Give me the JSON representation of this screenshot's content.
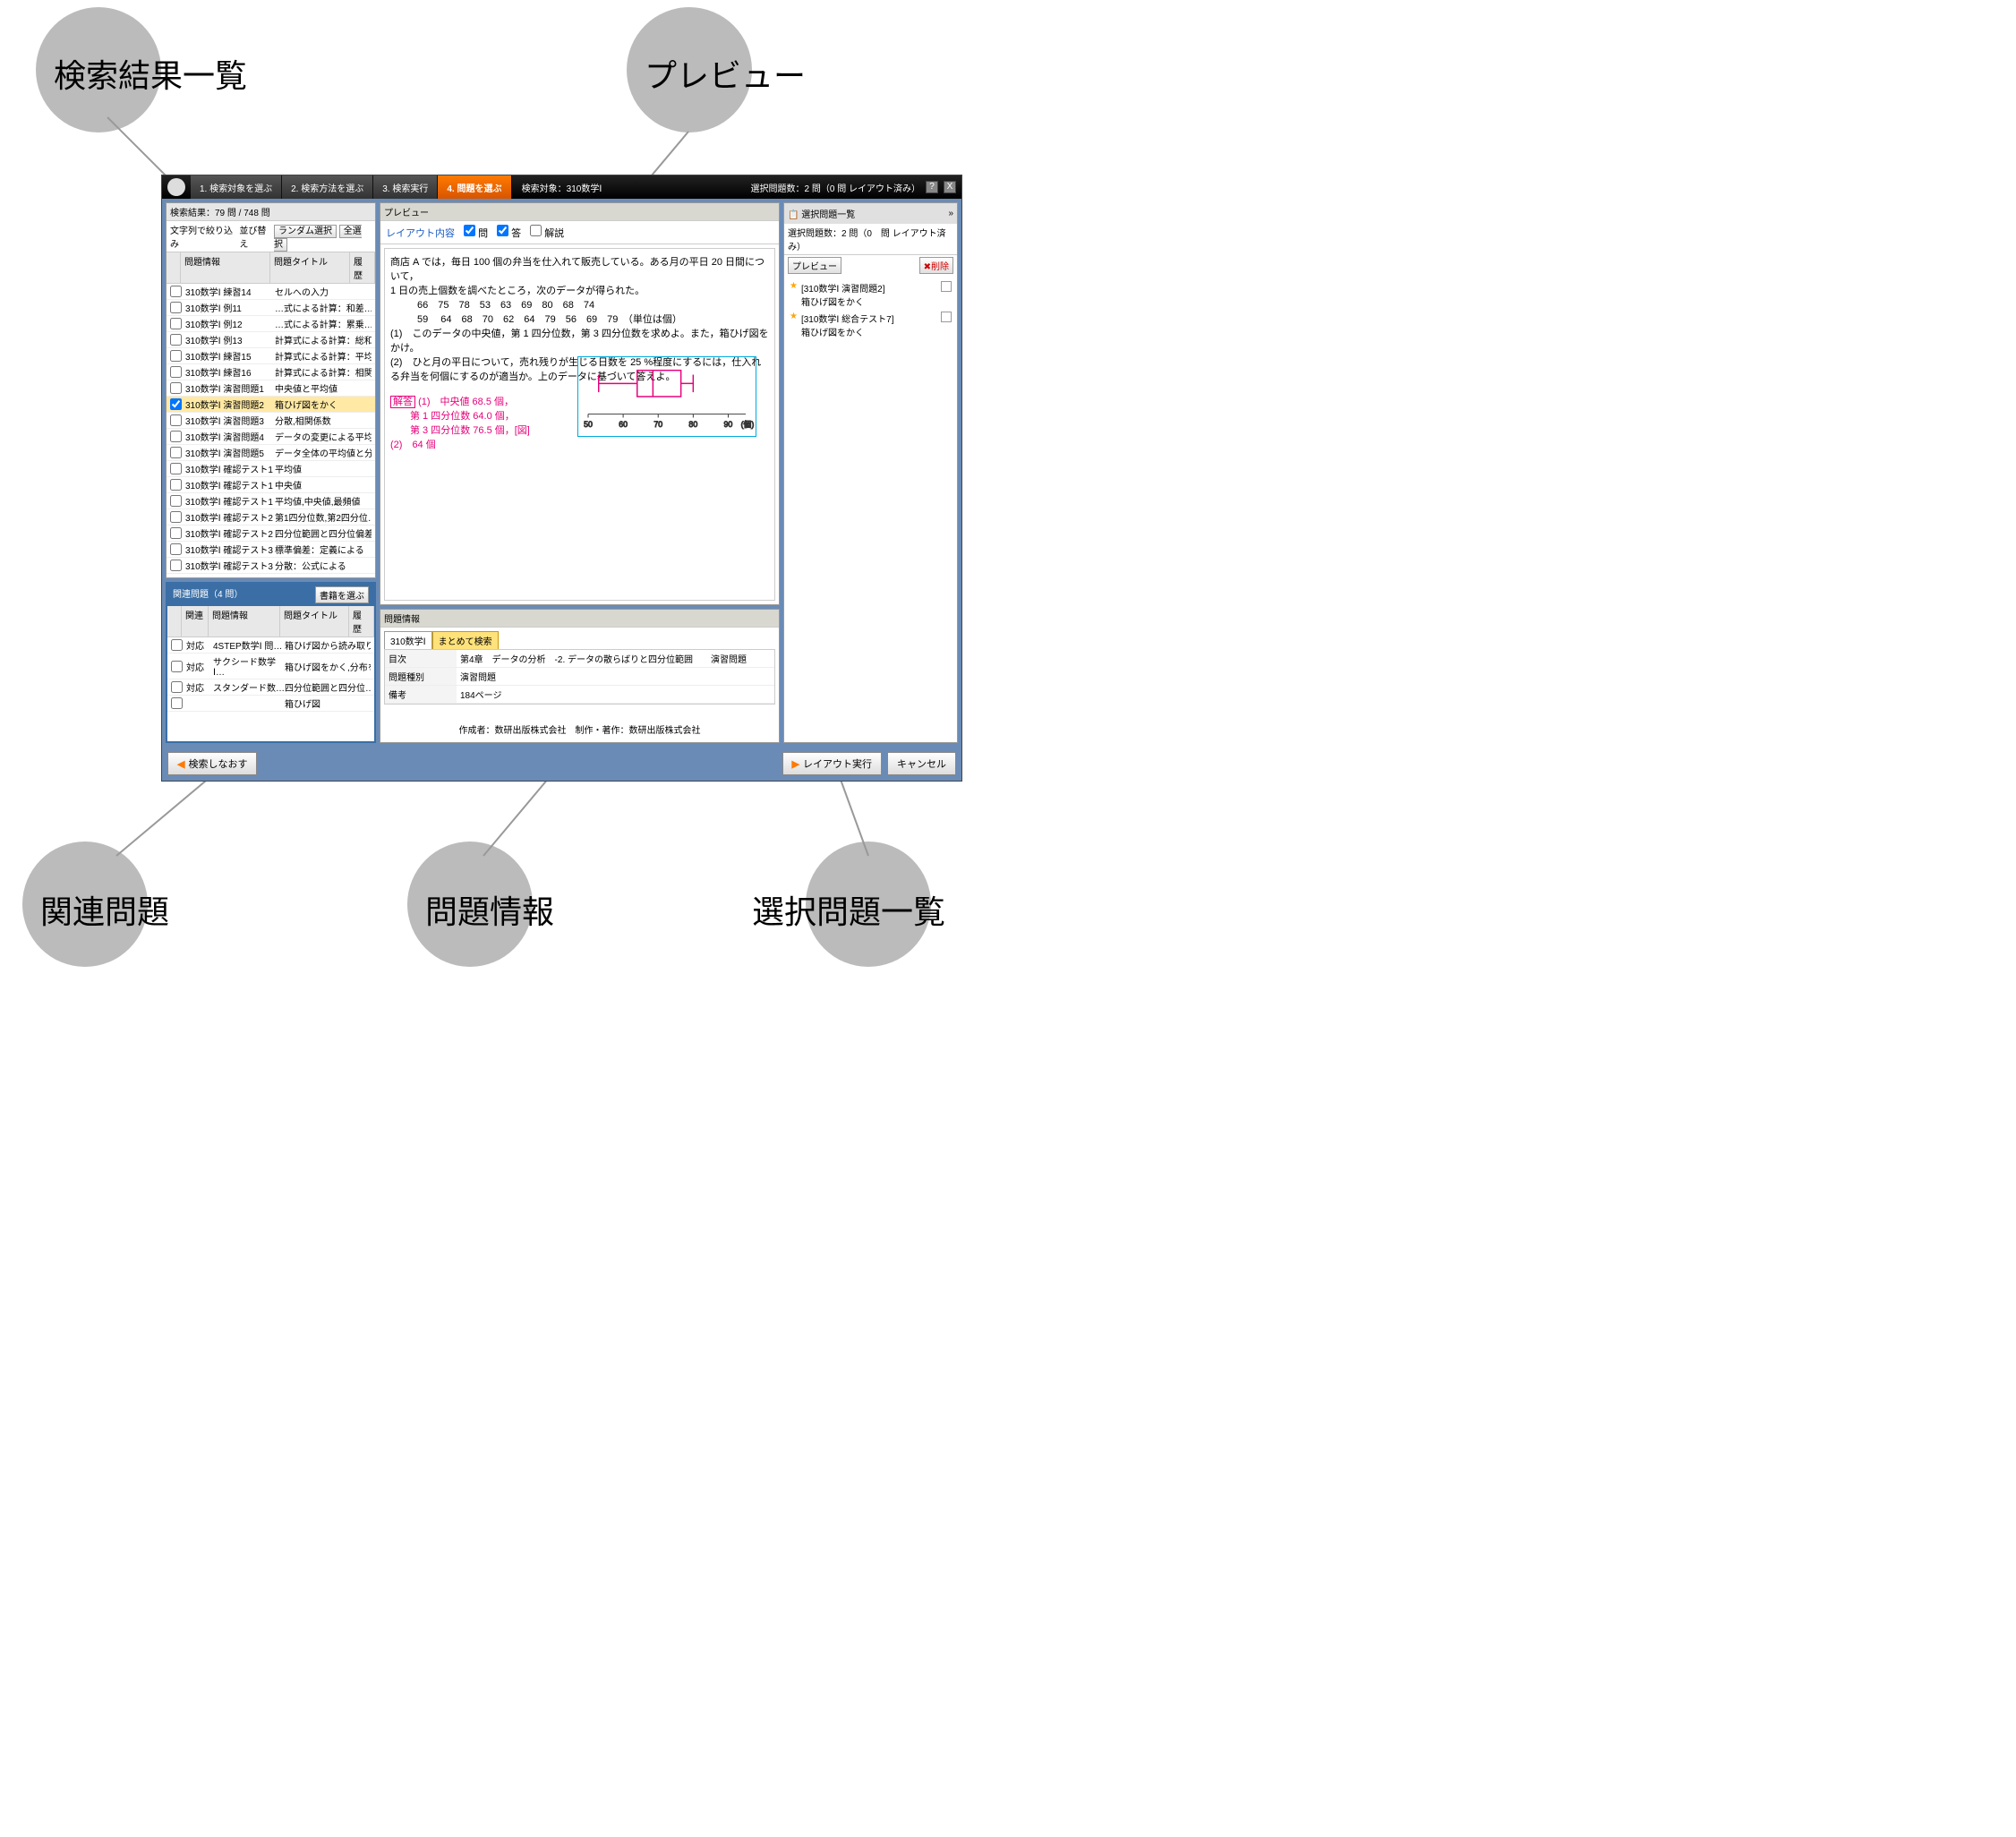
{
  "callouts": {
    "top_left": "検索結果一覧",
    "top_right": "プレビュー",
    "bottom_left": "関連問題",
    "bottom_mid": "問題情報",
    "bottom_right": "選択問題一覧"
  },
  "top": {
    "step1": "1. 検索対象を選ぶ",
    "step2": "2. 検索方法を選ぶ",
    "step3": "3. 検索実行",
    "step4": "4. 問題を選ぶ",
    "center": "検索対象：310数学Ⅰ",
    "right": "選択問題数：2 問（0 問 レイアウト済み）",
    "help": "?",
    "close": "X"
  },
  "search": {
    "result_header": "検索結果：79 問 / 748 問",
    "filter_label": "文字列で絞り込み",
    "sort_label": "並び替え",
    "random_btn": "ランダム選択",
    "all_btn": "全選択",
    "col_info": "問題情報",
    "col_title": "問題タイトル",
    "col_hist": "履歴",
    "rows": [
      {
        "info": "310数学Ⅰ 練習14",
        "title": "セルへの入力"
      },
      {
        "info": "310数学Ⅰ 例11",
        "title": "…式による計算：和差…"
      },
      {
        "info": "310数学Ⅰ 例12",
        "title": "…式による計算：累乗…"
      },
      {
        "info": "310数学Ⅰ 例13",
        "title": "計算式による計算：総和"
      },
      {
        "info": "310数学Ⅰ 練習15",
        "title": "計算式による計算：平均…"
      },
      {
        "info": "310数学Ⅰ 練習16",
        "title": "計算式による計算：相関…"
      },
      {
        "info": "310数学Ⅰ 演習問題1",
        "title": "中央値と平均値"
      },
      {
        "info": "310数学Ⅰ 演習問題2",
        "title": "箱ひげ図をかく"
      },
      {
        "info": "310数学Ⅰ 演習問題3",
        "title": "分散,相関係数"
      },
      {
        "info": "310数学Ⅰ 演習問題4",
        "title": "データの変更による平均値…"
      },
      {
        "info": "310数学Ⅰ 演習問題5",
        "title": "データ全体の平均値と分散"
      },
      {
        "info": "310数学Ⅰ 確認テスト1",
        "title": "平均値"
      },
      {
        "info": "310数学Ⅰ 確認テスト1",
        "title": "中央値"
      },
      {
        "info": "310数学Ⅰ 確認テスト1",
        "title": "平均値,中央値,最頻値"
      },
      {
        "info": "310数学Ⅰ 確認テスト2",
        "title": "第1四分位数,第2四分位…"
      },
      {
        "info": "310数学Ⅰ 確認テスト2",
        "title": "四分位範囲と四分位偏差…"
      },
      {
        "info": "310数学Ⅰ 確認テスト3",
        "title": "標準偏差：定義による"
      },
      {
        "info": "310数学Ⅰ 確認テスト3",
        "title": "分散：公式による"
      }
    ]
  },
  "related": {
    "header": "関連問題（4 問）",
    "select_book_btn": "書籍を選ぶ",
    "col_rel": "関連",
    "col_info": "問題情報",
    "col_title": "問題タイトル",
    "col_hist": "履歴",
    "rows": [
      {
        "rel": "対応",
        "info": "4STEP数学Ⅰ 問…",
        "title": "箱ひげ図から読み取り"
      },
      {
        "rel": "対応",
        "info": "サクシード数学Ⅰ…",
        "title": "箱ひげ図をかく,分布を…"
      },
      {
        "rel": "対応",
        "info": "スタンダード数…",
        "title": "四分位範囲と四分位…"
      },
      {
        "rel": "",
        "info": "",
        "title": "箱ひげ図"
      }
    ]
  },
  "preview": {
    "panel_title": "プレビュー",
    "layout_label": "レイアウト内容",
    "chk_q": "問",
    "chk_a": "答",
    "chk_exp": "解説",
    "body_line1": "商店 A では，毎日 100 個の弁当を仕入れて販売している。ある月の平日 20 日間について，",
    "body_line2": "1 日の売上個数を調べたところ，次のデータが得られた。",
    "body_data1": "66　75　78　53　63　69　80　68　74",
    "body_data2": "59　 64　68　70　62　64　79　56　69　79　（単位は個）",
    "body_q1": "(1)　このデータの中央値，第 1 四分位数，第 3 四分位数を求めよ。また，箱ひげ図をかけ。",
    "body_q2": "(2)　ひと月の平日について，売れ残りが生じる日数を 25 %程度にするには，仕入れる弁当を何個にするのが適当か。上のデータに基づいて答えよ。",
    "ans_label": "解答",
    "ans1": "(1)　中央値 68.5 個，",
    "ans2": "　　第 1 四分位数 64.0 個，",
    "ans3": "　　第 3 四分位数 76.5 個，[図]",
    "ans4": "(2)　64 個"
  },
  "info": {
    "panel_title": "問題情報",
    "tab1": "310数学Ⅰ",
    "tab2": "まとめて検索",
    "row_toc_k": "目次",
    "row_toc_v": "第4章　データの分析　-2. データの散らばりと四分位範囲　　演習問題",
    "row_type_k": "問題種別",
    "row_type_v": "演習問題",
    "row_note_k": "備考",
    "row_note_v": "184ページ",
    "credit": "作成者：数研出版株式会社　制作・著作：数研出版株式会社"
  },
  "selected": {
    "header": "選択問題一覧",
    "chevron": "»",
    "sub": "選択問題数：2 問（0　問 レイアウト済み）",
    "preview_btn": "プレビュー",
    "delete_btn": "✖削除",
    "items": [
      {
        "title": "[310数学Ⅰ 演習問題2]",
        "sub": "箱ひげ図をかく"
      },
      {
        "title": "[310数学Ⅰ 総合テスト7]",
        "sub": "箱ひげ図をかく"
      }
    ]
  },
  "bottom": {
    "back": "検索しなおす",
    "layout": "レイアウト実行",
    "cancel": "キャンセル"
  },
  "chart_data": {
    "type": "boxplot",
    "title": "",
    "xlabel": "（個）",
    "xlim": [
      50,
      95
    ],
    "ticks": [
      50,
      60,
      70,
      80,
      90
    ],
    "min": 53,
    "q1": 64.0,
    "median": 68.5,
    "q3": 76.5,
    "max": 80
  }
}
